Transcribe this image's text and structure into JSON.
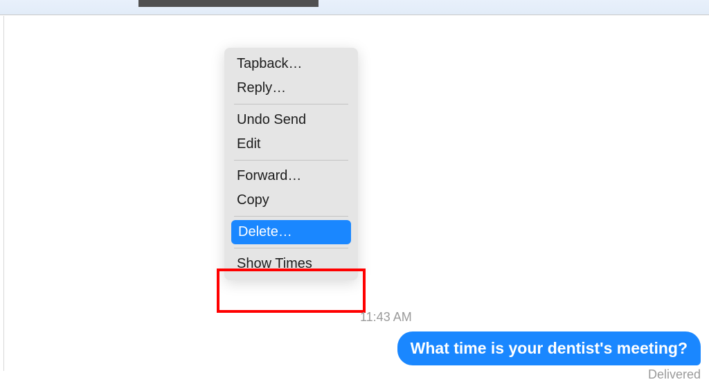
{
  "menu": {
    "items": {
      "tapback": "Tapback…",
      "reply": "Reply…",
      "undo_send": "Undo Send",
      "edit": "Edit",
      "forward": "Forward…",
      "copy": "Copy",
      "delete": "Delete…",
      "show_times": "Show Times"
    }
  },
  "chat": {
    "timestamp": "11:43 AM",
    "message": "What time is your dentist's meeting?",
    "status": "Delivered"
  }
}
